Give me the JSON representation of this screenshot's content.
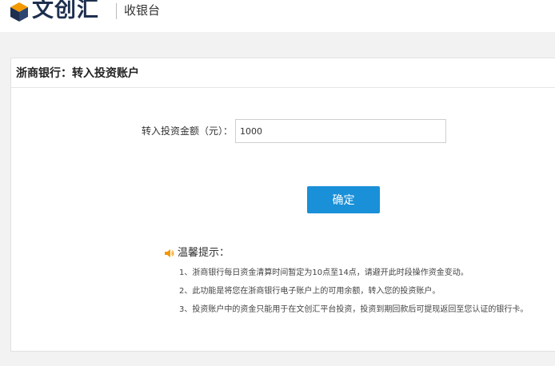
{
  "header": {
    "logo_text": "文创汇",
    "cashier_title": "收银台"
  },
  "card": {
    "title": "浙商银行：转入投资账户",
    "amount_label": "转入投资金额（元）：",
    "amount_value": "1000",
    "confirm_label": "确定"
  },
  "tips": {
    "title": "温馨提示：",
    "items": [
      "1、浙商银行每日资金清算时间暂定为10点至14点，请避开此时段操作资金变动。",
      "2、此功能是将您在浙商银行电子账户上的可用余额，转入您的投资账户。",
      "3、投资账户中的资金只能用于在文创汇平台投资，投资到期回款后可提现返回至您认证的银行卡。"
    ]
  },
  "colors": {
    "primary_button": "#1a90d8",
    "tips_icon": "#f39800",
    "logo_dark": "#1e2f4f",
    "logo_accent": "#f39800"
  },
  "icons": {
    "logo": "wenchuanghui-logo-icon",
    "tips": "speaker-icon"
  }
}
